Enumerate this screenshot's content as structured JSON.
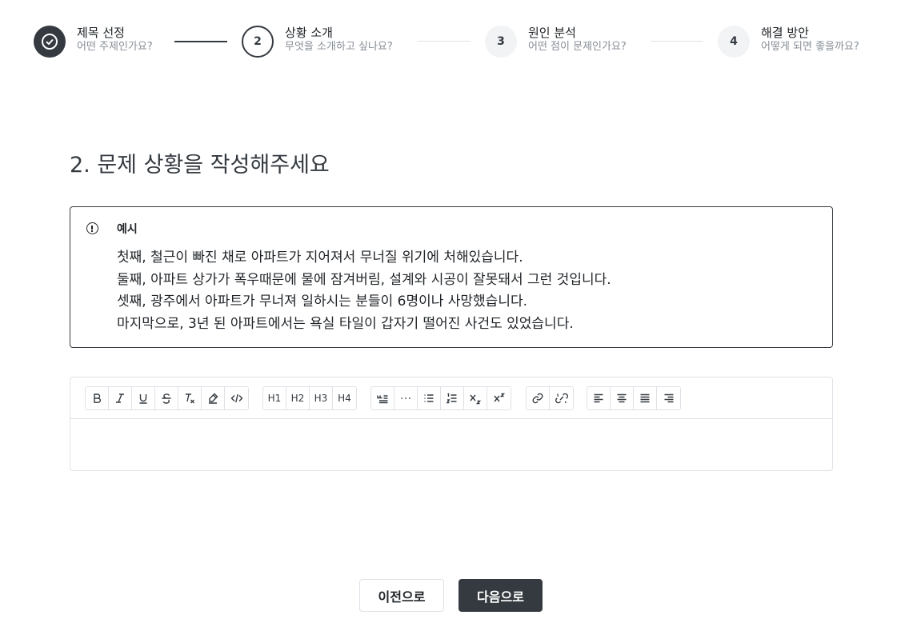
{
  "stepper": {
    "steps": [
      {
        "number": "",
        "title": "제목 선정",
        "subtitle": "어떤 주제인가요?",
        "state": "done"
      },
      {
        "number": "2",
        "title": "상황 소개",
        "subtitle": "무엇을 소개하고 싶나요?",
        "state": "active"
      },
      {
        "number": "3",
        "title": "원인 분석",
        "subtitle": "어떤 점이 문제인가요?",
        "state": "todo"
      },
      {
        "number": "4",
        "title": "해결 방안",
        "subtitle": "어떻게 되면 좋을까요?",
        "state": "todo"
      }
    ]
  },
  "page_title": "2. 문제 상황을 작성해주세요",
  "example": {
    "label": "예시",
    "lines": [
      "첫째, 철근이 빠진 채로 아파트가 지어져서 무너질 위기에 처해있습니다.",
      "둘째, 아파트 상가가 폭우때문에 물에 잠겨버림, 설계와 시공이 잘못돼서 그런 것입니다.",
      "셋째, 광주에서 아파트가 무너져 일하시는 분들이 6명이나 사망했습니다.",
      "마지막으로, 3년 된 아파트에서는 욕실 타일이 갑자기 떨어진 사건도 있었습니다."
    ]
  },
  "toolbar": {
    "format_icons": [
      "bold-icon",
      "italic-icon",
      "underline-icon",
      "strikethrough-icon",
      "clear-format-icon",
      "highlight-icon",
      "code-icon"
    ],
    "headings": [
      "H1",
      "H2",
      "H3",
      "H4"
    ],
    "block_icons": [
      "blockquote-icon",
      "horizontal-rule-icon",
      "bullet-list-icon",
      "ordered-list-icon",
      "subscript-icon",
      "superscript-icon"
    ],
    "link_icons": [
      "link-icon",
      "unlink-icon"
    ],
    "align_icons": [
      "align-left-icon",
      "align-center-icon",
      "align-justify-icon",
      "align-right-icon"
    ]
  },
  "buttons": {
    "prev_label": "이전으로",
    "next_label": "다음으로"
  },
  "colors": {
    "primary": "#343a40",
    "muted": "#868e96",
    "border": "#dee2e6"
  }
}
